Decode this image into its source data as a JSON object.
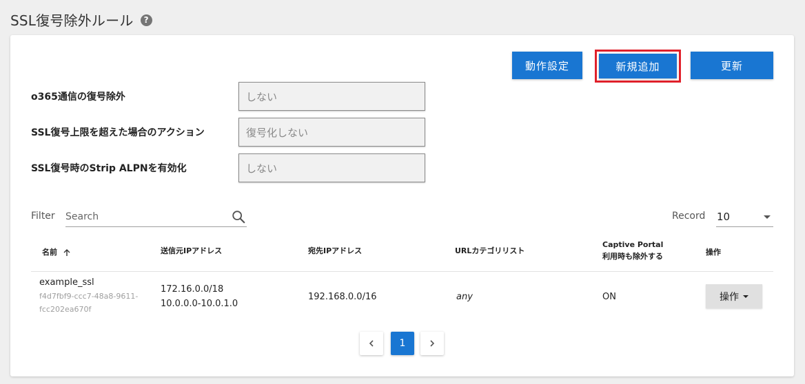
{
  "page": {
    "title": "SSL復号除外ルール",
    "help_glyph": "?"
  },
  "toolbar": {
    "settings_label": "動作設定",
    "add_label": "新規追加",
    "refresh_label": "更新"
  },
  "settings": [
    {
      "label": "o365通信の復号除外",
      "value": "しない"
    },
    {
      "label": "SSL復号上限を超えた場合のアクション",
      "value": "復号化しない"
    },
    {
      "label": "SSL復号時のStrip ALPNを有効化",
      "value": "しない"
    }
  ],
  "filter": {
    "label": "Filter",
    "placeholder": "Search"
  },
  "record": {
    "label": "Record",
    "value": "10"
  },
  "table": {
    "headers": {
      "name": "名前",
      "source_ip": "送信元IPアドレス",
      "dest_ip": "宛先IPアドレス",
      "url_category": "URLカテゴリリスト",
      "captive_line1": "Captive Portal",
      "captive_line2": "利用時も除外する",
      "actions": "操作"
    },
    "rows": [
      {
        "name": "example_ssl",
        "uuid_line1": "f4d7fbf9-ccc7-48a8-9611-",
        "uuid_line2": "fcc202ea670f",
        "source_ip_1": "172.16.0.0/18",
        "source_ip_2": "10.0.0.0-10.0.1.0",
        "dest_ip": "192.168.0.0/16",
        "url_category": "any",
        "captive_portal": "ON",
        "action_label": "操作"
      }
    ]
  },
  "pagination": {
    "current_page": "1"
  },
  "colors": {
    "primary": "#1976d2",
    "highlight": "#e0202a"
  }
}
